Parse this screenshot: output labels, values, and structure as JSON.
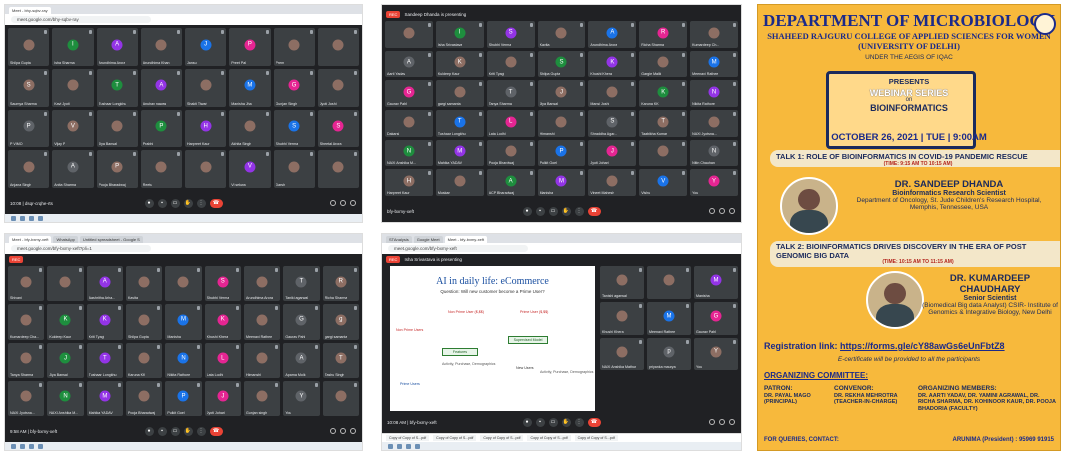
{
  "screenshots": [
    {
      "id": "s1",
      "tabs": [
        "Meet - bhy-sqbv-ray"
      ],
      "url": "meet.google.com/bhy-sqbv-ray",
      "meeting_code": "10:08 | dsqr-crqhe-rts",
      "participants": [
        "Shilpa Gupta",
        "Isha Sharma",
        "Arundhima Arora",
        "Arundhima Khan",
        "Jansu",
        "Preet Pal",
        "Prem",
        "",
        "Saumya Sharma",
        "Kavi Jyoti",
        "Tushaar Longkhu",
        "Anuhav nawas",
        "Shakti Tiwari",
        "Manisha Jha",
        "Gunjan Singh",
        "Jyoti Joshi",
        "P VIMO",
        "Vijay P",
        "Jiya Bansal",
        "Prabhi",
        "Harpreet Kaur",
        "Akhita Singh",
        "Shubhi Verma",
        "Sheetal Arora",
        "Anjana Singh",
        "Anita Sharma",
        "Pooja Bharadwaj",
        "Reetu",
        "",
        "Vi sekwa",
        "Darsh",
        ""
      ]
    },
    {
      "id": "s2",
      "presenting": "Sandeep Dhanda is presenting",
      "meeting_code": "bfy-bxmy-xeft",
      "participants": [
        "",
        "Isha Srivastava",
        "Shubhi Verma",
        "Kavita",
        "Arundhima Arora",
        "Richa Sharma",
        "Kumardeep Ch...",
        "Aarti Yadav",
        "Kuldeep Kaur",
        "Kriti Tyagi",
        "Shilpa Gupta",
        "Khushi Khera",
        "Gargie Malik",
        "Meenaxi Rathee",
        "Gaurav Pahl",
        "gargi samanta",
        "Tanya Sharma",
        "Jiya Bansal",
        "Mansi Joshi",
        "Karuna KK",
        "Nikita Rathore",
        "Dakarsi",
        "Tushaar Longkhu",
        "Lata Lodhi",
        "Himanshi",
        "Shraddha Agar...",
        "Taabikha Kumar",
        "NAXI Jyotsna...",
        "NAXI Anshika M...",
        "Mahika YADAV",
        "Pooja Bhardwaj",
        "Pulkit Goel",
        "Jyoti Johari",
        "",
        "Nitin Chauhan",
        "Harpreet Kaur",
        "Muskan",
        "ACP Bharadwaj",
        "Manisha",
        "Vineet Mahesh",
        "Vishu",
        "You"
      ]
    },
    {
      "id": "s3",
      "tabs": [
        "Meet - bfy-bxmy-xeft",
        "WhatsApp",
        "Untitled spreadsheet - Google S"
      ],
      "url": "meet.google.com/bfy-bxmy-xeft?pli=1",
      "meeting_code": "9:58 AM | bfy-bxmy-xeft",
      "participants": [
        "Shivani",
        "",
        "Aashritha Arha...",
        "Kavita",
        "",
        "Shubhi Verma",
        "Arundhima Arora",
        "Taniki agarwal",
        "Richa Sharma",
        "Kumardeep Cha...",
        "Kuldeep Kaur",
        "Kriti Tyagi",
        "Shilpa Gupta",
        "Manisha",
        "Khushi Khera",
        "Meenaxi Rathee",
        "Gaurav Pahl",
        "gargi samanta",
        "Tanya Sharma",
        "Jiya Bansal",
        "Tushaar Longkhu",
        "Karuna KK",
        "Nikita Rathore",
        "Lata Lodhi",
        "Himanshi",
        "Aparna Molk",
        "Tashu Singh",
        "NAXI Jyotsna...",
        "NAXI Anshika M...",
        "Mahika YADAV",
        "Pooja Bharadwaj",
        "Pulkit Goel",
        "Jyoti Johari",
        "Gunjan singh",
        "You",
        ""
      ]
    },
    {
      "id": "s4",
      "tabs": [
        "STAnalysis",
        "Google Meet",
        "Meet - bfy-bxmy-xeft"
      ],
      "url": "meet.google.com/bfy-bxmy-xeft",
      "presenting": "Isha Srivastava is presenting",
      "meeting_code": "10:08 AM | bfy-bxmy-xeft",
      "slide": {
        "title": "AI in daily life: eCommerce",
        "question": "Question: Will new customer become a Prime User?",
        "labels": [
          "Non Prime Users",
          "Non Prime User ($,$$)",
          "Prime User ($,$$)",
          "Supervised Model",
          "Features",
          "Activity, Purchase, Demographics",
          "New Users",
          "Activity, Purchase, Demographics",
          "Prime Users"
        ]
      },
      "participants": [
        "Tanishi agarwal",
        "",
        "Manisha",
        "Khushi Khera",
        "Meenaxi Rathee",
        "Gaurav Pahl",
        "NAXI Anshika Mathur",
        "priyanka maurya",
        "You"
      ],
      "downloads": [
        "Copy of Copy of S...pdf",
        "Copy of Copy of S...pdf",
        "Copy of Copy of S...pdf",
        "Copy of Copy of S...pdf",
        "Copy of Copy of S...pdf"
      ]
    }
  ],
  "poster": {
    "dept": "DEPARTMENT OF MICROBIOLOGY",
    "college": "SHAHEED RAJGURU COLLEGE OF APPLIED SCIENCES FOR WOMEN",
    "uni": "(UNIVERSITY OF DELHI)",
    "under": "UNDER THE AEGIS OF IQAC",
    "presents": "PRESENTS",
    "webinar": "WEBINAR SERIES",
    "on": "on",
    "topic": "BIOINFORMATICS",
    "date": "OCTOBER 26, 2021 | TUE | 9:00AM",
    "talk1": "TALK 1: ROLE OF BIOINFORMATICS IN COVID-19 PANDEMIC RESCUE",
    "talk1_time": "(TIME: 9:15 AM TO 10:15 AM)",
    "sp1_name": "DR. SANDEEP DHANDA",
    "sp1_role": "Bioinformatics Research Scientist",
    "sp1_aff": "Department of Oncology, St. Jude Children's Research Hospital, Memphis, Tennessee, USA",
    "talk2": "TALK 2: BIOINFORMATICS DRIVES DISCOVERY IN THE ERA OF POST GENOMIC BIG DATA",
    "talk2_time": "(TIME: 10:15 AM TO 11:15 AM)",
    "sp2_name": "DR. KUMARDEEP CHAUDHARY",
    "sp2_role": "Senior Scientist",
    "sp2_aff": "(Biomedical Big data Analyst) CSIR- Institute of Genomics & Integrative Biology, New Delhi",
    "reg_label": "Registration link:",
    "reg_link": "https://forms.gle/cY88awGs6eUnFbtZ8",
    "cert": "E-certificate will be provided to all the participants",
    "org_title": "ORGANIZING COMMITTEE:",
    "patron_h": "PATRON:",
    "patron": "DR. PAYAL MAGO (PRINCIPAL)",
    "convenor_h": "CONVENOR:",
    "convenor": "DR. REKHA MEHROTRA (TEACHER-IN-CHARGE)",
    "members_h": "ORGANIZING MEMBERS:",
    "members": "DR. AARTI YADAV, DR. YAMINI AGRAWAL, DR. RICHA SHARMA, DR. KOHINOOR KAUR, DR. POOJA BHADORIA (FACULTY)",
    "queries": "FOR QUERIES, CONTACT:",
    "arunima": "ARUNIMA (President) : 95969 91915"
  },
  "colors": {
    "meet_bg": "#202124",
    "tile": "#3c4043",
    "end_call": "#ea4335",
    "poster_bg": "#f7b93c",
    "poster_text": "#1b2a8a"
  }
}
